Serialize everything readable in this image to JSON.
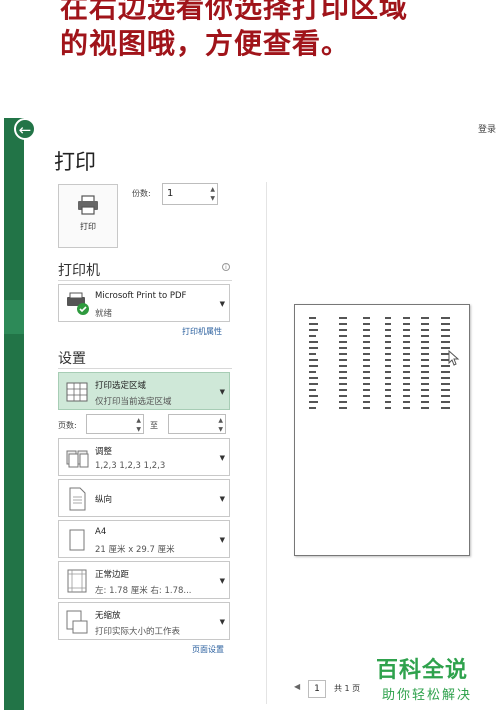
{
  "caption": {
    "line1": "在右边选看你选择打印区域",
    "line2": "的视图哦，方便查看。"
  },
  "header": {
    "login": "登录"
  },
  "title": "打印",
  "print_button": {
    "label": "打印",
    "icon": "printer-icon"
  },
  "copies": {
    "label": "份数:",
    "value": "1"
  },
  "printer": {
    "section_title": "打印机",
    "name": "Microsoft Print to PDF",
    "status": "就绪",
    "properties_link": "打印机属性",
    "icon": "printer-ready-icon"
  },
  "settings": {
    "section_title": "设置",
    "items": [
      {
        "main": "打印选定区域",
        "sub": "仅打印当前选定区域",
        "icon": "selection-grid-icon",
        "selected": true
      },
      {
        "main": "调整",
        "sub": "1,2,3    1,2,3    1,2,3",
        "icon": "collate-icon"
      },
      {
        "main": "纵向",
        "sub": "",
        "icon": "portrait-icon"
      },
      {
        "main": "A4",
        "sub": "21 厘米 x 29.7 厘米",
        "icon": "paper-size-icon"
      },
      {
        "main": "正常边距",
        "sub": "左: 1.78 厘米    右: 1.78...",
        "icon": "margins-icon"
      },
      {
        "main": "无缩放",
        "sub": "打印实际大小的工作表",
        "icon": "no-scaling-icon"
      }
    ],
    "pages_label": "页数:",
    "to_label": "至",
    "page_setup_link": "页面设置"
  },
  "preview": {
    "page_input": "1",
    "total": "共 1 页"
  },
  "watermark": {
    "brand": "百科全说",
    "slogan": "助你轻松解决"
  }
}
